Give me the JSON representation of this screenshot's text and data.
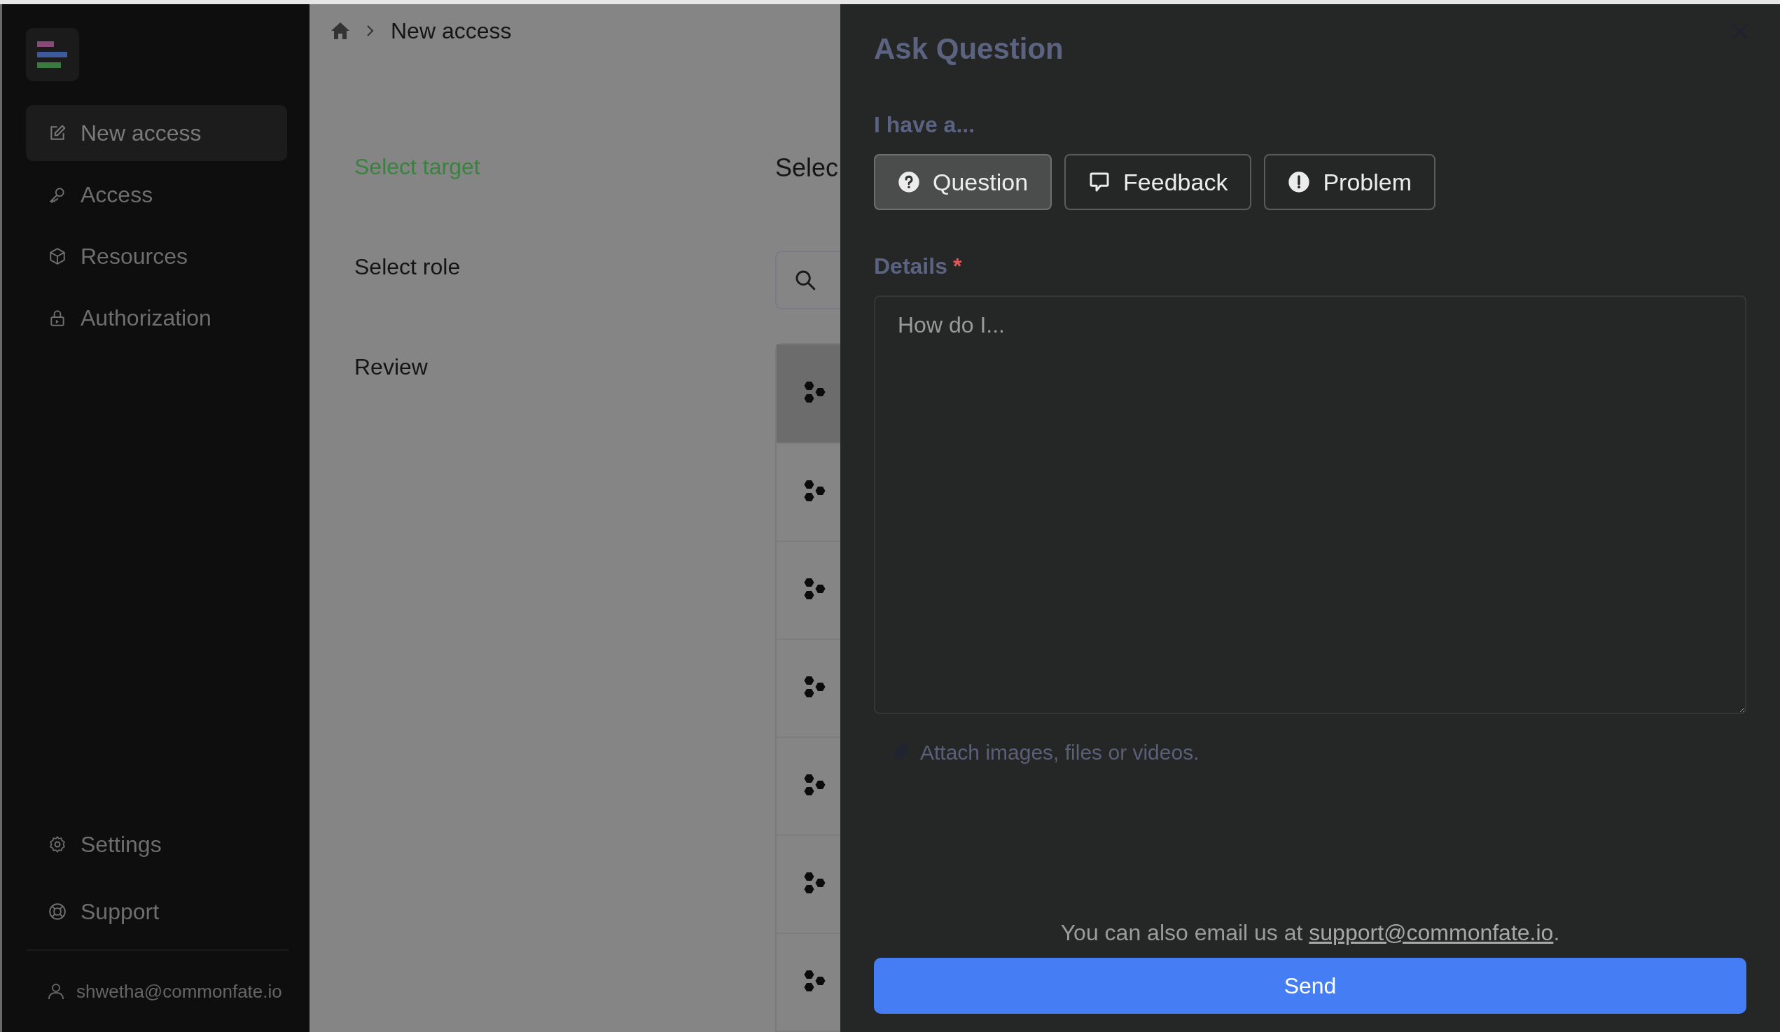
{
  "sidebar": {
    "items": [
      {
        "label": "New access",
        "kind": "edit",
        "selected": true
      },
      {
        "label": "Access",
        "kind": "key",
        "selected": false
      },
      {
        "label": "Resources",
        "kind": "box",
        "selected": false
      },
      {
        "label": "Authorization",
        "kind": "lock",
        "selected": false
      }
    ],
    "footer_items": [
      {
        "label": "Settings",
        "kind": "gear",
        "selected": false
      },
      {
        "label": "Support",
        "kind": "lifebuoy",
        "selected": false
      }
    ],
    "user": "shwetha@commonfate.io"
  },
  "breadcrumb": {
    "current": "New access"
  },
  "steps": [
    {
      "label": "Select target",
      "active": true
    },
    {
      "label": "Select role",
      "active": false
    },
    {
      "label": "Review",
      "active": false
    }
  ],
  "content": {
    "heading": "Selec",
    "rows": [
      {
        "selected": true
      },
      {
        "selected": false
      },
      {
        "selected": false
      },
      {
        "selected": false
      },
      {
        "selected": false
      },
      {
        "selected": false
      },
      {
        "selected": false
      }
    ]
  },
  "panel": {
    "title": "Ask Question",
    "type_label": "I have a...",
    "types": [
      {
        "label": "Question",
        "kind": "question",
        "selected": true
      },
      {
        "label": "Feedback",
        "kind": "speech",
        "selected": false
      },
      {
        "label": "Problem",
        "kind": "alert",
        "selected": false
      }
    ],
    "details_label": "Details",
    "required_mark": "*",
    "details": {
      "placeholder": "How do I..."
    },
    "attach": "Attach images, files or videos.",
    "email_text": "You can also email us at ",
    "email_link": "support@commonfate.io",
    "email_end": ".",
    "send": "Send"
  }
}
